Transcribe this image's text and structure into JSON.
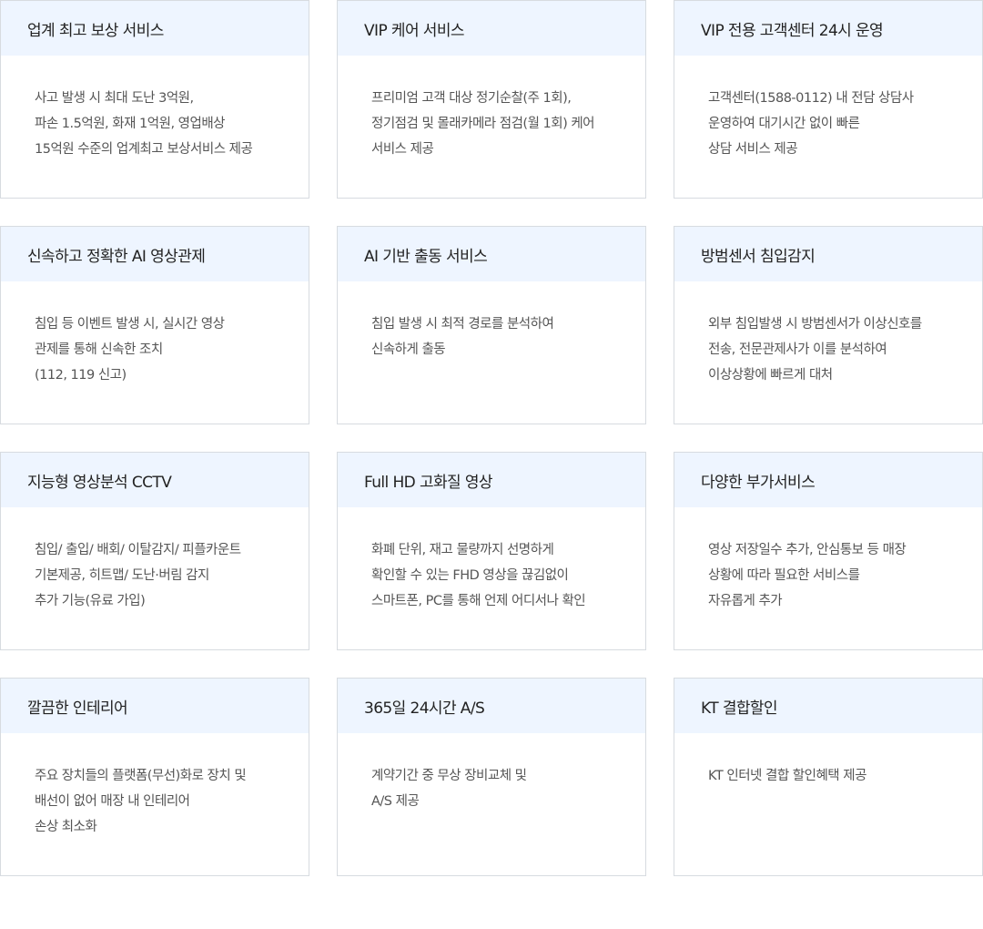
{
  "cards": [
    {
      "title": "업계 최고 보상 서비스",
      "lines": [
        "사고 발생 시 최대 도난 3억원,",
        "파손 1.5억원, 화재 1억원, 영업배상",
        "15억원 수준의 업계최고 보상서비스 제공"
      ]
    },
    {
      "title": "VIP 케어 서비스",
      "lines": [
        "프리미엄 고객 대상 정기순찰(주 1회),",
        "정기점검 및 몰래카메라 점검(월 1회) 케어",
        "서비스 제공"
      ]
    },
    {
      "title": "VIP 전용 고객센터 24시 운영",
      "lines": [
        "고객센터(1588-0112) 내 전담 상담사",
        "운영하여 대기시간 없이 빠른",
        "상담 서비스 제공"
      ]
    },
    {
      "title": "신속하고 정확한 AI 영상관제",
      "lines": [
        "침입 등 이벤트 발생 시, 실시간 영상",
        "관제를 통해 신속한 조치",
        "(112, 119 신고)"
      ]
    },
    {
      "title": "AI 기반 출동 서비스",
      "lines": [
        "침입 발생 시 최적 경로를 분석하여",
        "신속하게 출동",
        ""
      ]
    },
    {
      "title": "방범센서 침입감지",
      "lines": [
        "외부 침입발생 시 방범센서가 이상신호를",
        "전송, 전문관제사가 이를 분석하여",
        "이상상황에 빠르게 대처"
      ]
    },
    {
      "title": "지능형 영상분석 CCTV",
      "lines": [
        "침입/ 출입/ 배회/ 이탈감지/ 피플카운트",
        "기본제공, 히트맵/ 도난·버림 감지",
        "추가 기능(유료 가입)"
      ]
    },
    {
      "title": "Full HD 고화질 영상",
      "lines": [
        "화폐 단위, 재고 물량까지 선명하게",
        "확인할 수 있는 FHD 영상을 끊김없이",
        "스마트폰, PC를 통해 언제 어디서나 확인"
      ]
    },
    {
      "title": "다양한 부가서비스",
      "lines": [
        "영상 저장일수 추가, 안심통보 등 매장",
        "상황에 따라 필요한 서비스를",
        "자유롭게 추가"
      ]
    },
    {
      "title": "깔끔한 인테리어",
      "lines": [
        "주요 장치들의 플랫폼(무선)화로 장치 및",
        "배선이 없어 매장 내 인테리어",
        "손상 최소화"
      ]
    },
    {
      "title": "365일 24시간 A/S",
      "lines": [
        "계약기간 중 무상 장비교체 및",
        "A/S 제공",
        ""
      ]
    },
    {
      "title": "KT 결합할인",
      "lines": [
        "KT 인터넷 결합 할인혜택 제공",
        "",
        ""
      ]
    }
  ]
}
